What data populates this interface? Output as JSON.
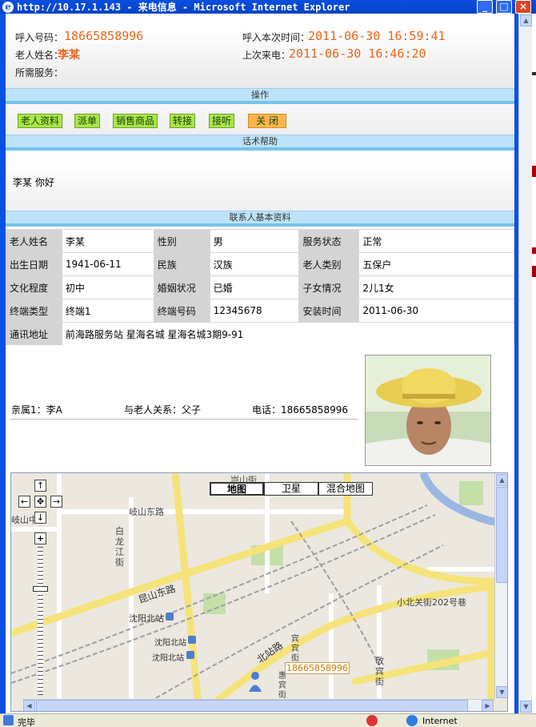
{
  "window": {
    "title": "http://10.17.1.143 - 来电信息 - Microsoft Internet Explorer",
    "min_btn": "_",
    "max_btn": "□",
    "close_btn": "×"
  },
  "call": {
    "caller_label": "呼入号码：",
    "caller_number": "18665858996",
    "current_time_label": "呼入本次时间：",
    "current_time": "2011-06-30 16:59:41",
    "elder_name_label": "老人姓名：",
    "elder_name": "李某",
    "last_call_label": "上次来电：",
    "last_call_time": "2011-06-30 16:46:20",
    "service_label": "所需服务："
  },
  "sections": {
    "operations": "操作",
    "script_help": "话术帮助",
    "contact_info": "联系人基本资料"
  },
  "operations": {
    "elder_profile": "老人资料",
    "dispatch": "派单",
    "sell_goods": "销售商品",
    "transfer": "转接",
    "answer": "接听",
    "close": "关 闭"
  },
  "script": {
    "greeting": "李某  你好"
  },
  "profile": {
    "rows": [
      [
        {
          "k": "老人姓名",
          "v": "李某"
        },
        {
          "k": "性别",
          "v": "男"
        },
        {
          "k": "服务状态",
          "v": "正常"
        }
      ],
      [
        {
          "k": "出生日期",
          "v": "1941-06-11"
        },
        {
          "k": "民族",
          "v": "汉族"
        },
        {
          "k": "老人类别",
          "v": "五保户"
        }
      ],
      [
        {
          "k": "文化程度",
          "v": "初中"
        },
        {
          "k": "婚姻状况",
          "v": "已婚"
        },
        {
          "k": "子女情况",
          "v": "2儿1女"
        }
      ],
      [
        {
          "k": "终端类型",
          "v": "终端1"
        },
        {
          "k": "终端号码",
          "v": "12345678"
        },
        {
          "k": "安装时间",
          "v": "2011-06-30"
        }
      ]
    ],
    "address_label": "通讯地址",
    "address": "前海路服务站  星海名城  星海名城3期9-91"
  },
  "relative": {
    "relative_text": "亲属1：李A",
    "relation_text": "与老人关系：父子",
    "phone_text": "电话：18665858996"
  },
  "map": {
    "type_map": "地图",
    "type_satellite": "卫星",
    "type_hybrid": "混合地图",
    "marker_label": "18665858996",
    "labels": {
      "top_street": "岂山街",
      "qishan_road": "岐山东路",
      "qishanzhong": "岐山中",
      "bailongjiang": "白龙江街",
      "kunshan_road": "昆山东路",
      "station1": "沈阳北站",
      "station2": "沈阳北站",
      "station3": "沈阳北站",
      "beizhan_road": "北站路",
      "xiaobeiguan": "小北关街202号巷",
      "jingbin": "敬宾街",
      "binbin": "宾宾街",
      "huibin": "惠宾街"
    }
  },
  "statusbar": {
    "left": "完毕",
    "zone": "Internet"
  },
  "colors": {
    "accent_orange": "#e8641a",
    "op_button_green": "#a8e64a",
    "close_button_orange": "#f9b650",
    "section_bar": "#bde3fa"
  }
}
